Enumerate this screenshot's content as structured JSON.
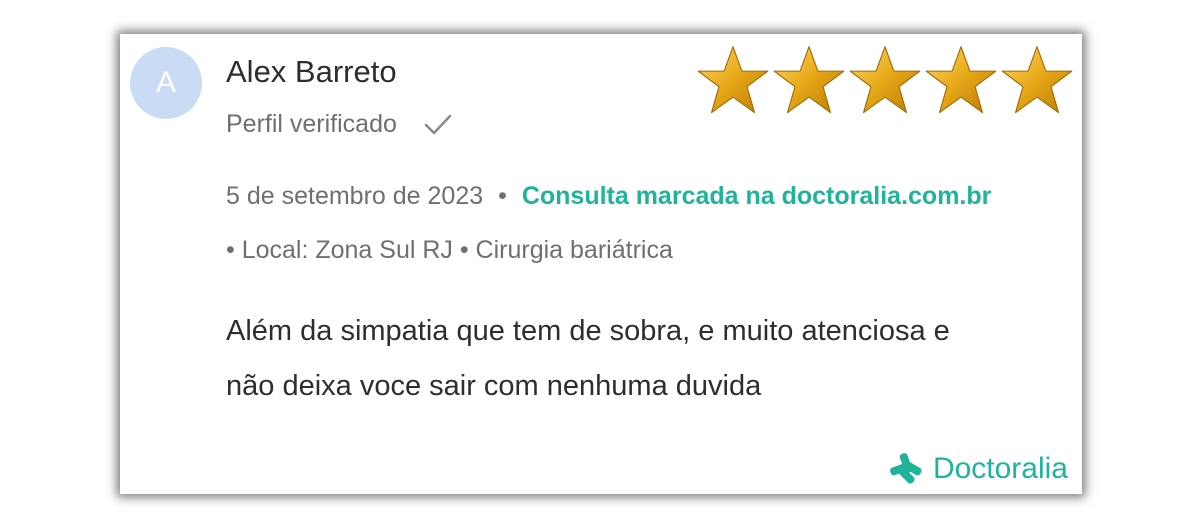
{
  "reviewer": {
    "initial": "A",
    "name": "Alex Barreto",
    "verified_label": "Perfil verificado",
    "verified_icon": "check-icon"
  },
  "rating": {
    "value": 5,
    "max": 5,
    "icon": "star-icon",
    "color": "#e6a817"
  },
  "meta": {
    "date": "5 de setembro de 2023",
    "separator": "•",
    "booking_text": "Consulta marcada na doctoralia.com.br",
    "location": "• Local: Zona Sul RJ • Cirurgia bariátrica"
  },
  "review": {
    "text": "Além da simpatia que tem de sobra, e muito atenciosa e não deixa voce sair com nenhuma duvida"
  },
  "brand": {
    "name": "Doctoralia",
    "icon": "doctoralia-logo-icon"
  },
  "colors": {
    "accent": "#1fb49a",
    "avatar_bg": "#c9dcf3",
    "text_primary": "#2e2e2e",
    "text_secondary": "#6f6f6f"
  }
}
